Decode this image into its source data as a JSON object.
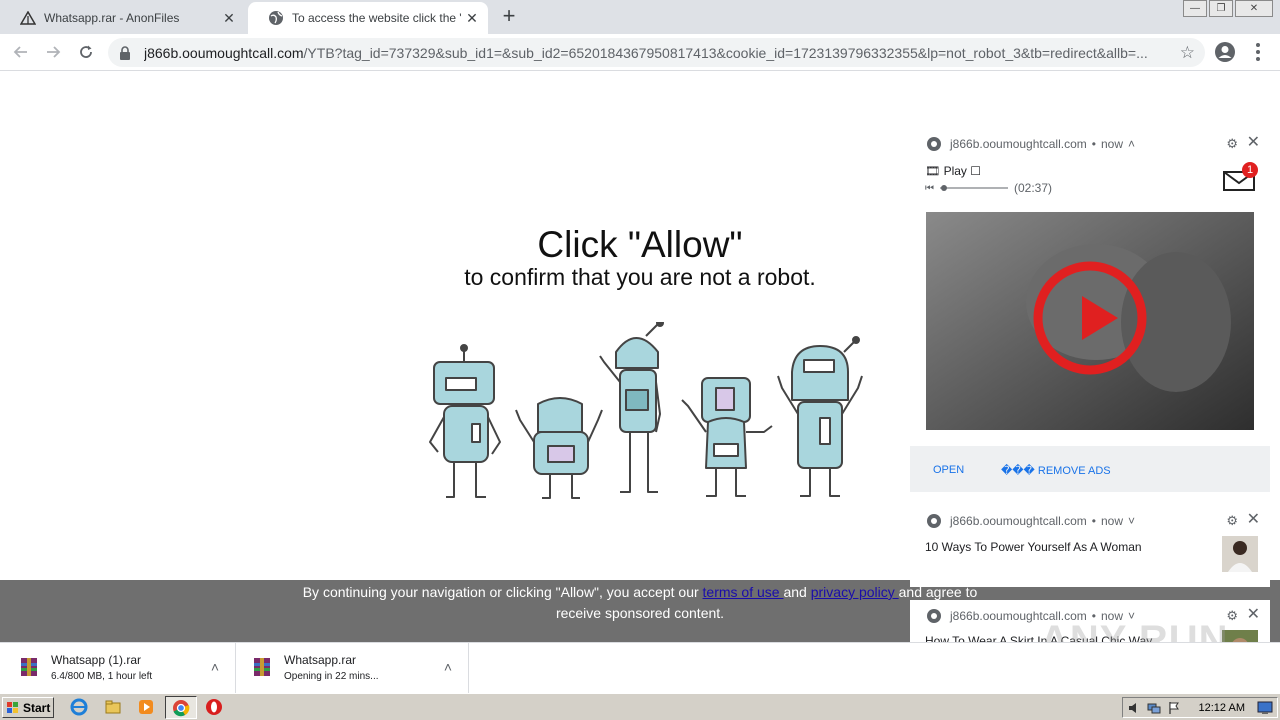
{
  "browser": {
    "tabs": [
      {
        "title": "Whatsapp.rar - AnonFiles",
        "active": false
      },
      {
        "title": "To access the website click the \"Allow\"",
        "active": true
      }
    ],
    "url_host": "j866b.ooumoughtcall.com",
    "url_path": "/YTB?tag_id=737329&sub_id1=&sub_id2=6520184367950817413&cookie_id=1723139796332355&lp=not_robot_3&tb=redirect&allb=..."
  },
  "page": {
    "headline": "Click \"Allow\"",
    "subline": "to confirm that you are not a robot.",
    "consent": {
      "part1": "By continuing your navigation or clicking \"Allow\", you accept our ",
      "terms": "terms of use ",
      "and": "and ",
      "privacy": "privacy policy ",
      "part2": "and agree to receive sponsored content."
    }
  },
  "notifications": [
    {
      "source": "j866b.ooumoughtcall.com",
      "time": "now",
      "chevron": "chevron-up",
      "play_label": "Play",
      "duration": "(02:37)",
      "badge": "1",
      "actions": [
        "OPEN",
        "��� REMOVE ADS"
      ]
    },
    {
      "source": "j866b.ooumoughtcall.com",
      "time": "now",
      "chevron": "chevron-down",
      "text": "10 Ways To Power Yourself As A Woman"
    },
    {
      "source": "j866b.ooumoughtcall.com",
      "time": "now",
      "chevron": "chevron-down",
      "text": "How To Wear A Skirt In A Casual Chic Way"
    }
  ],
  "downloads": [
    {
      "name": "Whatsapp (1).rar",
      "status": "6.4/800 MB, 1 hour left"
    },
    {
      "name": "Whatsapp.rar",
      "status": "Opening in 22 mins..."
    }
  ],
  "taskbar": {
    "start_label": "Start",
    "clock": "12:12 AM"
  },
  "watermark": "ANY RUN",
  "colors": {
    "accent": "#1a73e8",
    "consent_bg": "#6f6f6f",
    "robot_fill": "#a9d6dd",
    "play_red": "#e02020"
  }
}
